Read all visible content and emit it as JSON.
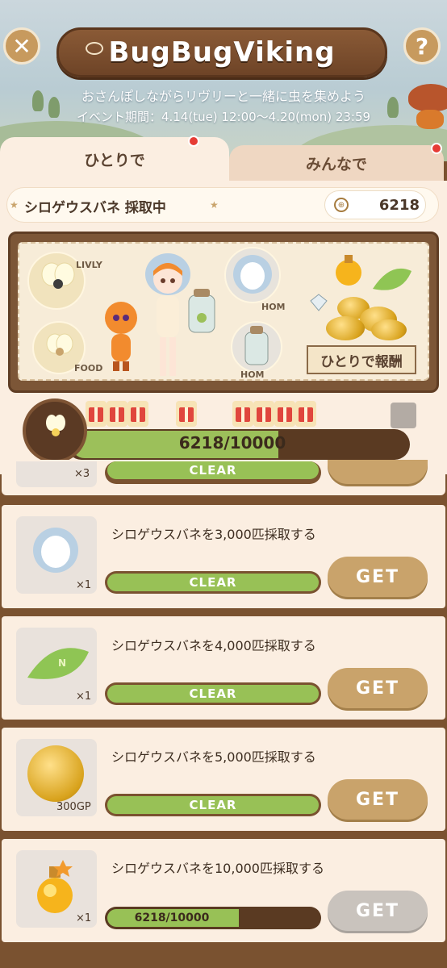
{
  "header": {
    "title": "BugBugViking",
    "subtitle": "おさんぽしながらリヴリーと一緒に虫を集めよう",
    "period": "イベント期間：4.14(tue) 12:00～4.20(mon) 23:59",
    "close_glyph": "✕",
    "help_glyph": "?"
  },
  "tabs": {
    "solo": "ひとりで",
    "all": "みんなで"
  },
  "status": {
    "label": "シロゲウスバネ 採取中",
    "count": "6218"
  },
  "rewards_board": {
    "slot_labels": [
      "LIVLY",
      "FOOD",
      "HOM",
      "HOM"
    ],
    "banner": "ひとりで報酬"
  },
  "progress": {
    "text": "6218/10000",
    "fraction": 0.6218
  },
  "quests": {
    "partial": {
      "mult": "×3",
      "clear": "CLEAR"
    },
    "items": [
      {
        "text": "シロゲウスバネを3,000匹採取する",
        "mult": "×1",
        "clear": "CLEAR",
        "get": "GET"
      },
      {
        "text": "シロゲウスバネを4,000匹採取する",
        "mult": "×1",
        "clear": "CLEAR",
        "get": "GET"
      },
      {
        "text": "シロゲウスバネを5,000匹採取する",
        "mult": "300GP",
        "clear": "CLEAR",
        "get": "GET"
      },
      {
        "text": "シロゲウスバネを10,000匹採取する",
        "mult": "×1",
        "progress": "6218/10000",
        "get": "GET",
        "fraction": 0.6218
      }
    ]
  },
  "colors": {
    "accent": "#c9a36b",
    "progress_green": "#98c156",
    "wood": "#7a5230",
    "notification": "#e63c35"
  }
}
